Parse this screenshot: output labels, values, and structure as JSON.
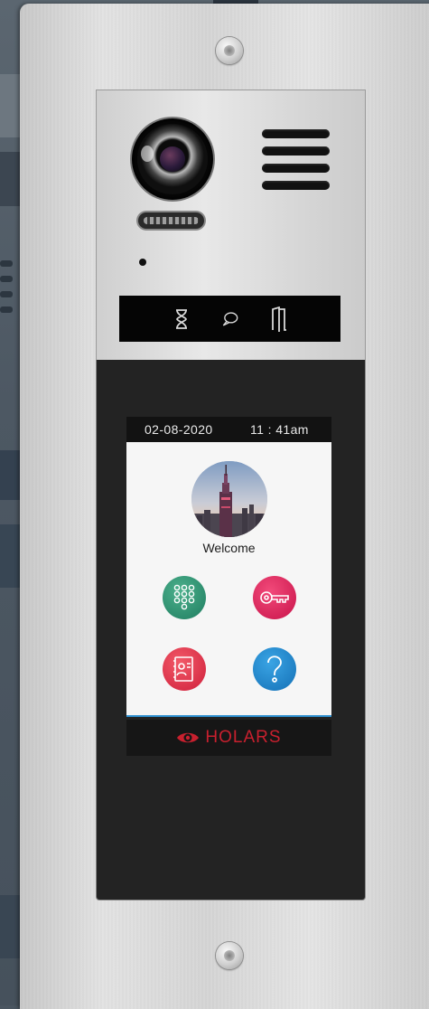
{
  "screen": {
    "date": "02-08-2020",
    "time": "11 : 41am",
    "welcome": "Welcome",
    "avatar_image": "city-skyline-avatar",
    "buttons": [
      {
        "name": "keypad",
        "icon": "keypad-icon",
        "color": "#2e9a74"
      },
      {
        "name": "key",
        "icon": "key-icon",
        "color": "#e0245a"
      },
      {
        "name": "contacts",
        "icon": "contacts-book-icon",
        "color": "#e23a4c"
      },
      {
        "name": "help",
        "icon": "question-icon",
        "color": "#2488d0"
      }
    ]
  },
  "status_icons": [
    "hourglass-icon",
    "speech-bubble-icon",
    "door-icon"
  ],
  "brand": {
    "logo_text": "HOLARS",
    "logo_color": "#c8202e"
  }
}
